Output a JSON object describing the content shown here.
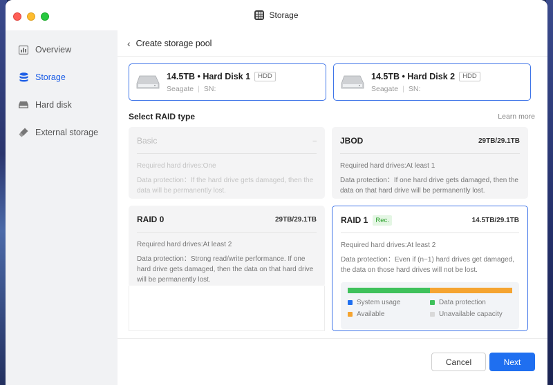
{
  "window": {
    "title": "Storage"
  },
  "sidebar": {
    "items": [
      {
        "label": "Overview",
        "icon": "overview-icon",
        "active": false
      },
      {
        "label": "Storage",
        "icon": "database-icon",
        "active": true
      },
      {
        "label": "Hard disk",
        "icon": "disk-icon",
        "active": false
      },
      {
        "label": "External storage",
        "icon": "usb-icon",
        "active": false
      }
    ]
  },
  "header": {
    "back_title": "Create storage pool"
  },
  "disks": [
    {
      "name": "14.5TB • Hard Disk 1",
      "tag": "HDD",
      "vendor": "Seagate",
      "sn": "SN:"
    },
    {
      "name": "14.5TB • Hard Disk 2",
      "tag": "HDD",
      "vendor": "Seagate",
      "sn": "SN:"
    }
  ],
  "raid_section": {
    "title": "Select RAID type",
    "learn_more": "Learn more"
  },
  "raid": [
    {
      "name": "Basic",
      "capacity": "–",
      "drives": "Required hard drives:One",
      "protection": "Data protection：If the hard drive gets damaged, then the data will be permanently lost.",
      "state": "disabled"
    },
    {
      "name": "JBOD",
      "capacity": "29TB/29.1TB",
      "drives": "Required hard drives:At least 1",
      "protection": "Data protection：If one hard drive gets damaged, then the data on that hard drive will be permanently lost.",
      "state": "normal"
    },
    {
      "name": "RAID 0",
      "capacity": "29TB/29.1TB",
      "drives": "Required hard drives:At least 2",
      "protection": "Data protection：Strong read/write performance. If one hard drive gets damaged, then the data on that hard drive will be permanently lost.",
      "state": "normal"
    },
    {
      "name": "RAID 1",
      "badge": "Rec.",
      "capacity": "14.5TB/29.1TB",
      "drives": "Required hard drives:At least 2",
      "protection": "Data protection：Even if (n−1) hard drives get damaged, the data on those hard drives will not be lost.",
      "state": "selected",
      "usage": {
        "data_protection_fraction": 0.5,
        "available_fraction": 0.5,
        "legend": {
          "system": "System usage",
          "data": "Data protection",
          "available": "Available",
          "unavailable": "Unavailable capacity"
        }
      }
    }
  ],
  "footer": {
    "cancel_label": "Cancel",
    "next_label": "Next"
  },
  "colors": {
    "accent": "#1f6ff0",
    "system_usage": "#1f6ff0",
    "data_protection": "#3fc15b",
    "available": "#f5a431",
    "unavailable": "#d9d9d9",
    "rec_badge": "#2aa02a"
  }
}
